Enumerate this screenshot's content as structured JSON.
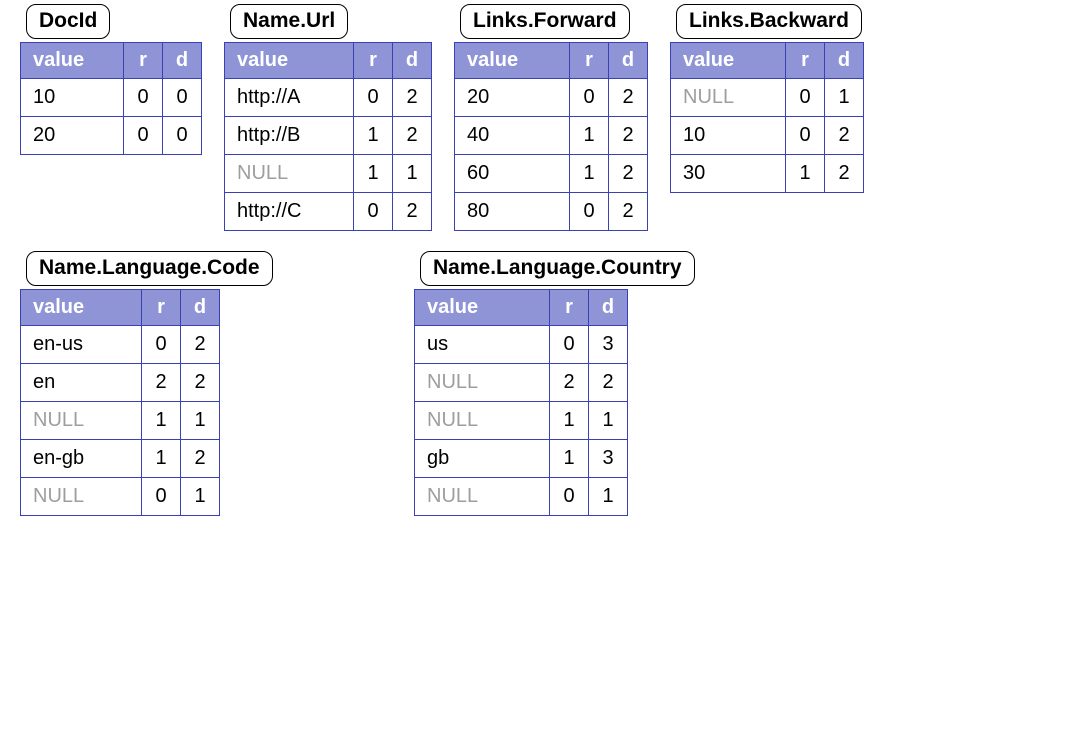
{
  "headers": {
    "value": "value",
    "r": "r",
    "d": "d"
  },
  "null_label": "NULL",
  "tables": {
    "docid": {
      "title": "DocId",
      "rows": [
        {
          "value": "10",
          "r": "0",
          "d": "0"
        },
        {
          "value": "20",
          "r": "0",
          "d": "0"
        }
      ]
    },
    "name_url": {
      "title": "Name.Url",
      "rows": [
        {
          "value": "http://A",
          "r": "0",
          "d": "2"
        },
        {
          "value": "http://B",
          "r": "1",
          "d": "2"
        },
        {
          "value": null,
          "r": "1",
          "d": "1"
        },
        {
          "value": "http://C",
          "r": "0",
          "d": "2"
        }
      ]
    },
    "links_forward": {
      "title": "Links.Forward",
      "rows": [
        {
          "value": "20",
          "r": "0",
          "d": "2"
        },
        {
          "value": "40",
          "r": "1",
          "d": "2"
        },
        {
          "value": "60",
          "r": "1",
          "d": "2"
        },
        {
          "value": "80",
          "r": "0",
          "d": "2"
        }
      ]
    },
    "links_backward": {
      "title": "Links.Backward",
      "rows": [
        {
          "value": null,
          "r": "0",
          "d": "1"
        },
        {
          "value": "10",
          "r": "0",
          "d": "2"
        },
        {
          "value": "30",
          "r": "1",
          "d": "2"
        }
      ]
    },
    "name_language_code": {
      "title": "Name.Language.Code",
      "rows": [
        {
          "value": "en-us",
          "r": "0",
          "d": "2"
        },
        {
          "value": "en",
          "r": "2",
          "d": "2"
        },
        {
          "value": null,
          "r": "1",
          "d": "1"
        },
        {
          "value": "en-gb",
          "r": "1",
          "d": "2"
        },
        {
          "value": null,
          "r": "0",
          "d": "1"
        }
      ]
    },
    "name_language_country": {
      "title": "Name.Language.Country",
      "rows": [
        {
          "value": "us",
          "r": "0",
          "d": "3"
        },
        {
          "value": null,
          "r": "2",
          "d": "2"
        },
        {
          "value": null,
          "r": "1",
          "d": "1"
        },
        {
          "value": "gb",
          "r": "1",
          "d": "3"
        },
        {
          "value": null,
          "r": "0",
          "d": "1"
        }
      ]
    }
  }
}
